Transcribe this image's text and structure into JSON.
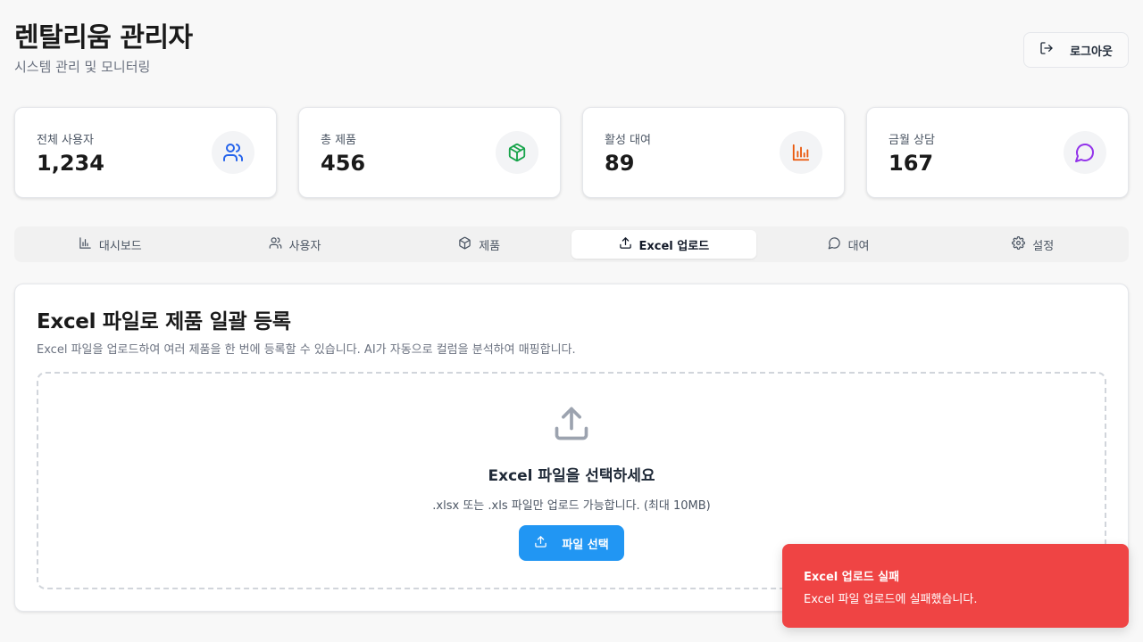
{
  "header": {
    "title": "렌탈리움 관리자",
    "subtitle": "시스템 관리 및 모니터링",
    "logout_label": "로그아웃"
  },
  "stats": [
    {
      "label": "전체 사용자",
      "value": "1,234",
      "icon": "users-icon",
      "color": "#2563eb"
    },
    {
      "label": "총 제품",
      "value": "456",
      "icon": "package-icon",
      "color": "#16a34a"
    },
    {
      "label": "활성 대여",
      "value": "89",
      "icon": "bar-chart-icon",
      "color": "#ea580c"
    },
    {
      "label": "금월 상담",
      "value": "167",
      "icon": "message-icon",
      "color": "#9333ea"
    }
  ],
  "tabs": [
    {
      "label": "대시보드",
      "icon": "bar-chart-icon",
      "active": false
    },
    {
      "label": "사용자",
      "icon": "users-icon",
      "active": false
    },
    {
      "label": "제품",
      "icon": "package-icon",
      "active": false
    },
    {
      "label": "Excel 업로드",
      "icon": "upload-icon",
      "active": true
    },
    {
      "label": "대여",
      "icon": "message-icon",
      "active": false
    },
    {
      "label": "설정",
      "icon": "gear-icon",
      "active": false
    }
  ],
  "panel": {
    "title": "Excel 파일로 제품 일괄 등록",
    "description": "Excel 파일을 업로드하여 여러 제품을 한 번에 등록할 수 있습니다. AI가 자동으로 컬럼을 분석하여 매핑합니다.",
    "dropzone": {
      "title": "Excel 파일을 선택하세요",
      "hint": ".xlsx 또는 .xls 파일만 업로드 가능합니다. (최대 10MB)",
      "button_label": "파일 선택"
    }
  },
  "toast": {
    "title": "Excel 업로드 실패",
    "message": "Excel 파일 업로드에 실패했습니다.",
    "color": "#ef4444"
  },
  "colors": {
    "accent": "#2196f3",
    "error": "#ef4444"
  }
}
